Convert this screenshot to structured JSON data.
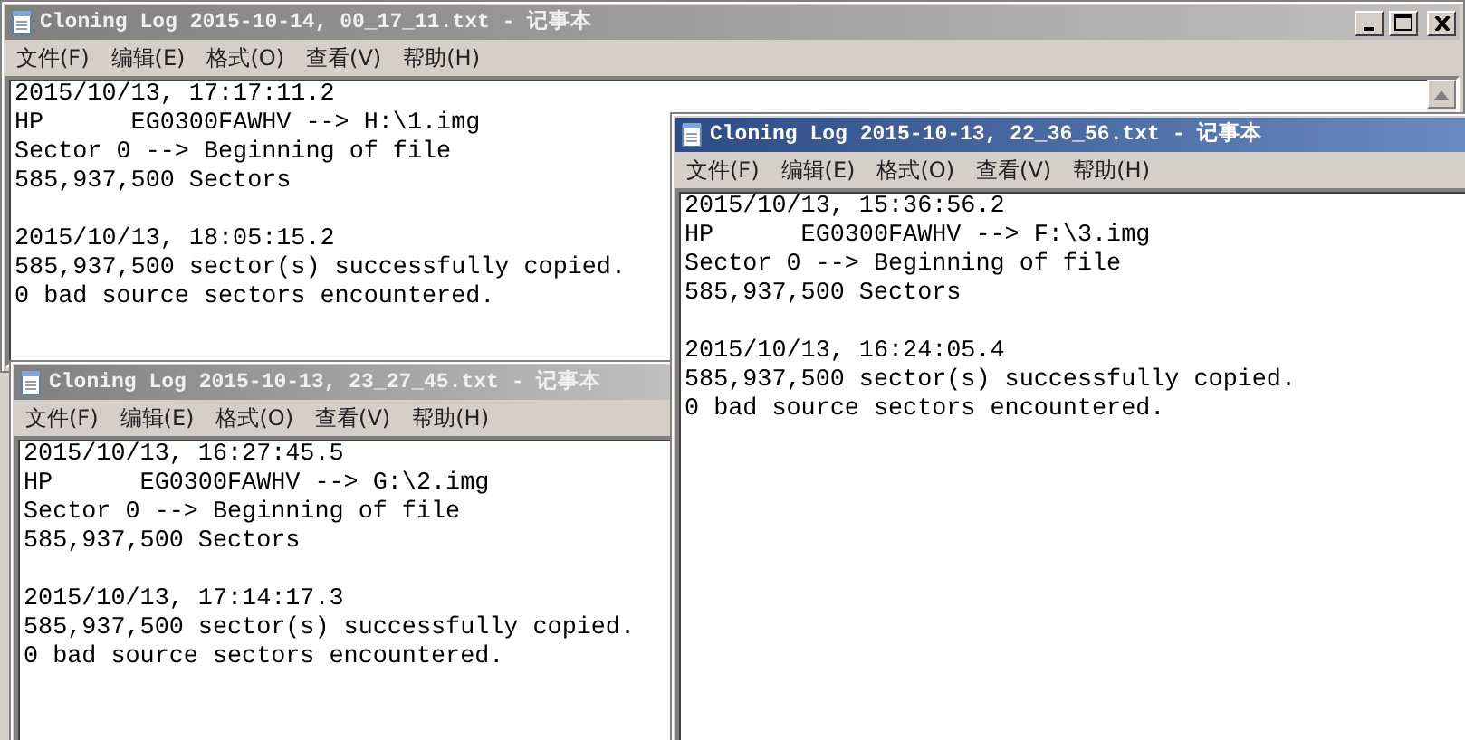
{
  "windows": [
    {
      "title": "Cloning Log 2015-10-14, 00_17_11.txt - 记事本",
      "active": false,
      "caption_buttons_visible": true,
      "scrollbar_visible": true,
      "menu": [
        "文件(F)",
        "编辑(E)",
        "格式(O)",
        "查看(V)",
        "帮助(H)"
      ],
      "paragraphs": [
        [
          "2015/10/13, 17:17:11.2",
          "HP      EG0300FAWHV --> H:\\1.img",
          "Sector 0 --> Beginning of file",
          "585,937,500 Sectors"
        ],
        [
          "2015/10/13, 18:05:15.2",
          "585,937,500 sector(s) successfully copied.",
          "0 bad source sectors encountered."
        ]
      ]
    },
    {
      "title": "Cloning Log 2015-10-13, 23_27_45.txt - 记事本",
      "active": false,
      "caption_buttons_visible": false,
      "scrollbar_visible": false,
      "menu": [
        "文件(F)",
        "编辑(E)",
        "格式(O)",
        "查看(V)",
        "帮助(H)"
      ],
      "paragraphs": [
        [
          "2015/10/13, 16:27:45.5",
          "HP      EG0300FAWHV --> G:\\2.img",
          "Sector 0 --> Beginning of file",
          "585,937,500 Sectors"
        ],
        [
          "2015/10/13, 17:14:17.3",
          "585,937,500 sector(s) successfully copied.",
          "0 bad source sectors encountered."
        ]
      ]
    },
    {
      "title": "Cloning Log 2015-10-13, 22_36_56.txt - 记事本",
      "active": true,
      "caption_buttons_visible": false,
      "scrollbar_visible": false,
      "menu": [
        "文件(F)",
        "编辑(E)",
        "格式(O)",
        "查看(V)",
        "帮助(H)"
      ],
      "paragraphs": [
        [
          "2015/10/13, 15:36:56.2",
          "HP      EG0300FAWHV --> F:\\3.img",
          "Sector 0 --> Beginning of file",
          "585,937,500 Sectors"
        ],
        [
          "2015/10/13, 16:24:05.4",
          "585,937,500 sector(s) successfully copied.",
          "0 bad source sectors encountered."
        ]
      ]
    }
  ]
}
